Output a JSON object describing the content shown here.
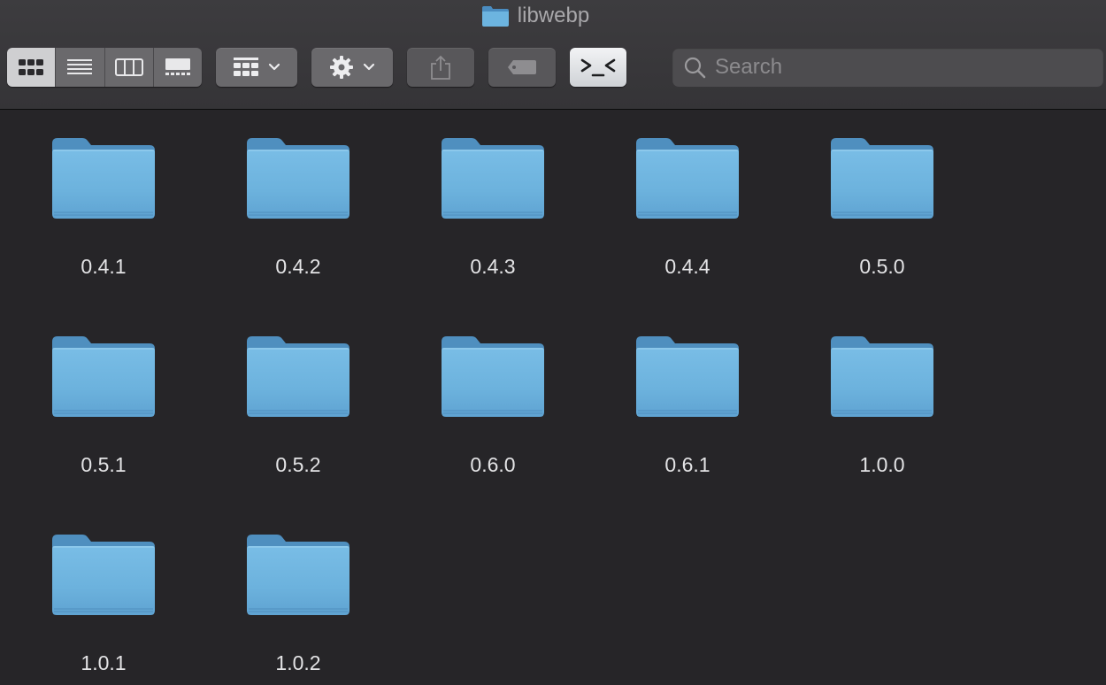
{
  "window": {
    "title": "libwebp"
  },
  "toolbar": {
    "view_modes": [
      "icon-view",
      "list-view",
      "column-view",
      "gallery-view"
    ],
    "active_view": "icon-view",
    "group_button": "group-by",
    "action_button": "action",
    "share_button": "share",
    "tag_button": "tags",
    "terminal_button": "terminal"
  },
  "search": {
    "placeholder": "Search",
    "value": ""
  },
  "colors": {
    "background": "#262528",
    "toolbar": "#3a393c",
    "folder_blue": "#6fb3dc",
    "folder_tab": "#4d8ebf",
    "label_text": "#e3e3e5"
  },
  "folders": [
    {
      "name": "0.4.1"
    },
    {
      "name": "0.4.2"
    },
    {
      "name": "0.4.3"
    },
    {
      "name": "0.4.4"
    },
    {
      "name": "0.5.0"
    },
    {
      "name": "0.5.1"
    },
    {
      "name": "0.5.2"
    },
    {
      "name": "0.6.0"
    },
    {
      "name": "0.6.1"
    },
    {
      "name": "1.0.0"
    },
    {
      "name": "1.0.1"
    },
    {
      "name": "1.0.2"
    }
  ]
}
